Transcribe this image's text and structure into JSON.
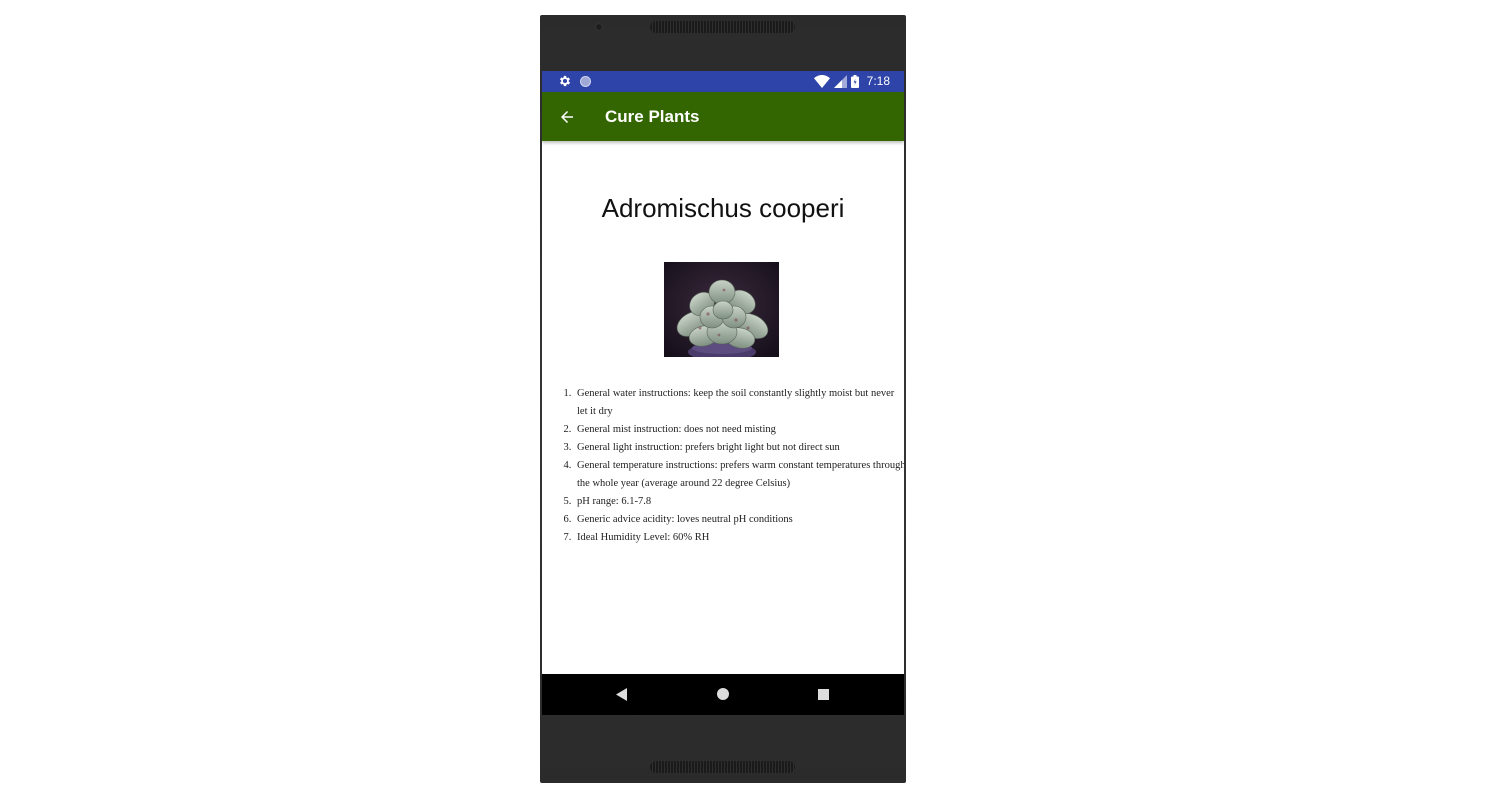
{
  "status_bar": {
    "time": "7:18",
    "left_icons": [
      "gear-icon",
      "circle-notification-icon"
    ],
    "right_icons": [
      "wifi-icon",
      "cell-signal-icon",
      "battery-icon"
    ]
  },
  "app_bar": {
    "title": "Cure Plants",
    "back_icon": "arrow-left-icon",
    "color": "#336600"
  },
  "plant": {
    "name": "Adromischus cooperi",
    "image_icon": "succulent-photo",
    "care": [
      "General water instructions: keep the soil constantly slightly moist but never let it dry",
      "General mist instruction: does not need misting",
      "General light instruction: prefers bright light but not direct sun",
      "General temperature instructions: prefers warm constant temperatures through the whole year (average around 22 degree Celsius)",
      "pH range:  6.1-7.8",
      "Generic advice acidity: loves neutral pH conditions",
      "Ideal Humidity Level: 60% RH"
    ]
  },
  "nav_bar": {
    "icons": [
      "back-triangle-icon",
      "home-circle-icon",
      "recents-square-icon"
    ]
  },
  "colors": {
    "status_bar": "#2f44a8",
    "app_bar": "#336600",
    "nav_bar": "#000000"
  }
}
